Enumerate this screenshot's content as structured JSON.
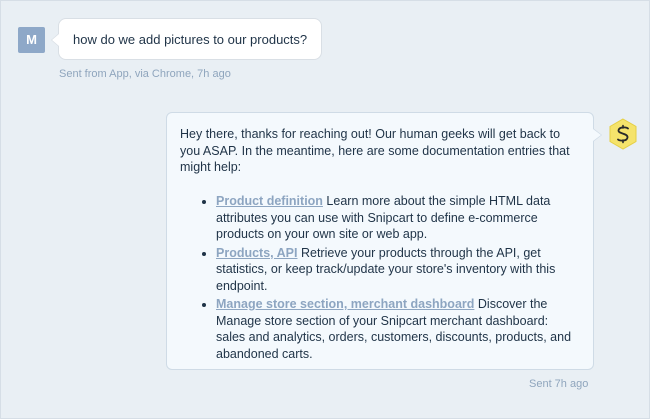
{
  "user_message": {
    "avatar_initial": "M",
    "text": "how do we add pictures to our products?",
    "meta": "Sent from App, via Chrome, 7h ago"
  },
  "operator_message": {
    "intro": "Hey there, thanks for reaching out! Our human geeks will get back to you ASAP. In the meantime, here are some documentation entries that might help:",
    "items": [
      {
        "link": "Product definition",
        "description": "Learn more about the simple HTML data attributes you can use with Snipcart to define e-commerce products on your own site or web app."
      },
      {
        "link": "Products, API",
        "description": "Retrieve your products through the API, get statistics, or keep track/update your store's inventory with this endpoint."
      },
      {
        "link": "Manage store section, merchant dashboard",
        "description": "Discover the Manage store section of your Snipcart merchant dashboard: sales and analytics, orders, customers, discounts, products, and abandoned carts."
      }
    ],
    "meta": "Sent 7h ago",
    "avatar_icon": "snipcart-logo-icon"
  },
  "colors": {
    "background": "#e9eff4",
    "user_avatar": "#8ea8c8",
    "link": "#8da5c1",
    "bot_avatar": "#f5e36b"
  }
}
